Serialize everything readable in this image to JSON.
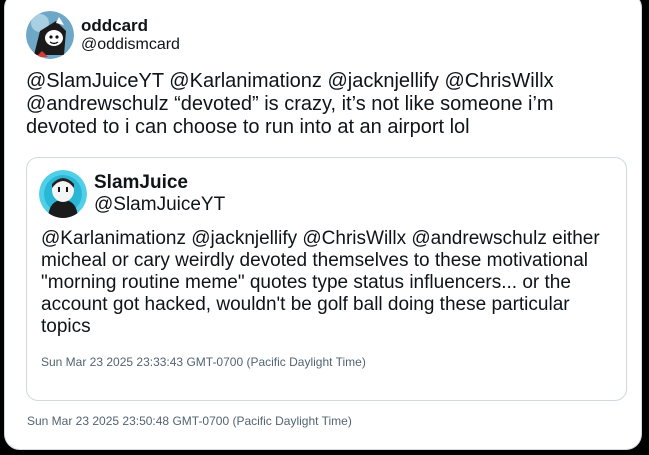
{
  "tweet": {
    "author": {
      "display_name": "oddcard",
      "handle": "@oddismcard"
    },
    "text": "@SlamJuiceYT @Karlanimationz @jacknjellify @ChrisWillx @andrewschulz “devoted” is crazy, it’s not like someone i’m devoted to i can choose to run into at an airport lol",
    "timestamp": "Sun Mar 23 2025 23:50:48 GMT-0700 (Pacific Daylight Time)"
  },
  "quoted_tweet": {
    "author": {
      "display_name": "SlamJuice",
      "handle": "@SlamJuiceYT"
    },
    "text": "@Karlanimationz @jacknjellify @ChrisWillx @andrewschulz either micheal or cary weirdly devoted themselves to these motivational \"morning routine meme\" quotes type status influencers... or the account got hacked, wouldn't be golf ball doing these particular topics",
    "timestamp": "Sun Mar 23 2025 23:33:43 GMT-0700 (Pacific Daylight Time)"
  },
  "colors": {
    "text": "#0f1419",
    "muted": "#536471",
    "border": "#cfd9de",
    "background_outer": "#000000",
    "card_background": "#ffffff"
  }
}
